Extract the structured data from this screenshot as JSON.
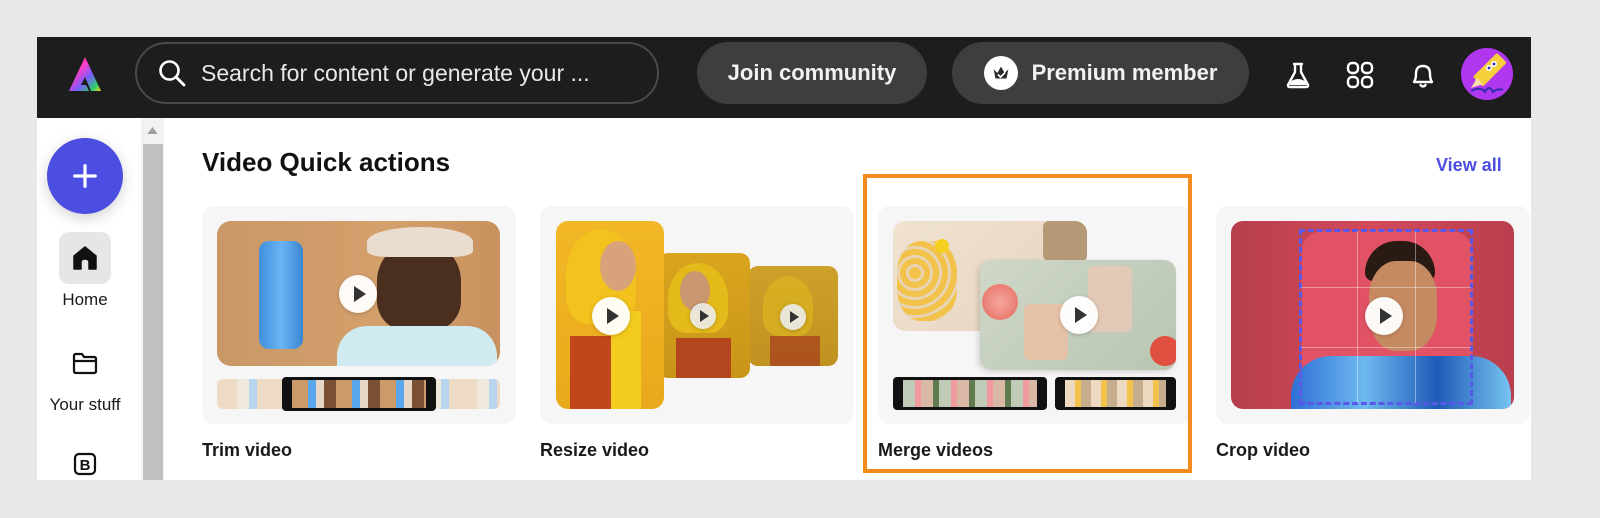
{
  "header": {
    "search_placeholder": "Search for content or generate your ...",
    "join_community": "Join community",
    "premium_member": "Premium member",
    "icons": [
      "adobe-express-logo",
      "search-icon",
      "crown-badge-icon",
      "labs-flask-icon",
      "apps-grid-icon",
      "bell-icon",
      "user-avatar"
    ]
  },
  "rail": {
    "create_button_icon": "plus-icon",
    "items": [
      {
        "label": "Home",
        "icon": "home-icon",
        "active": true
      },
      {
        "label": "Your stuff",
        "icon": "folder-icon",
        "active": false
      },
      {
        "label": "",
        "icon": "brand-b-icon",
        "active": false
      }
    ]
  },
  "main": {
    "section_title": "Video Quick actions",
    "view_all": "View all",
    "cards": [
      {
        "title": "Trim video"
      },
      {
        "title": "Resize video"
      },
      {
        "title": "Merge videos",
        "highlighted": true
      },
      {
        "title": "Crop video"
      }
    ]
  },
  "colors": {
    "accent": "#4b4ee0",
    "header_bg": "#1d1d1d",
    "highlight": "#f58a1f",
    "page_bg": "#e8e8e8"
  }
}
